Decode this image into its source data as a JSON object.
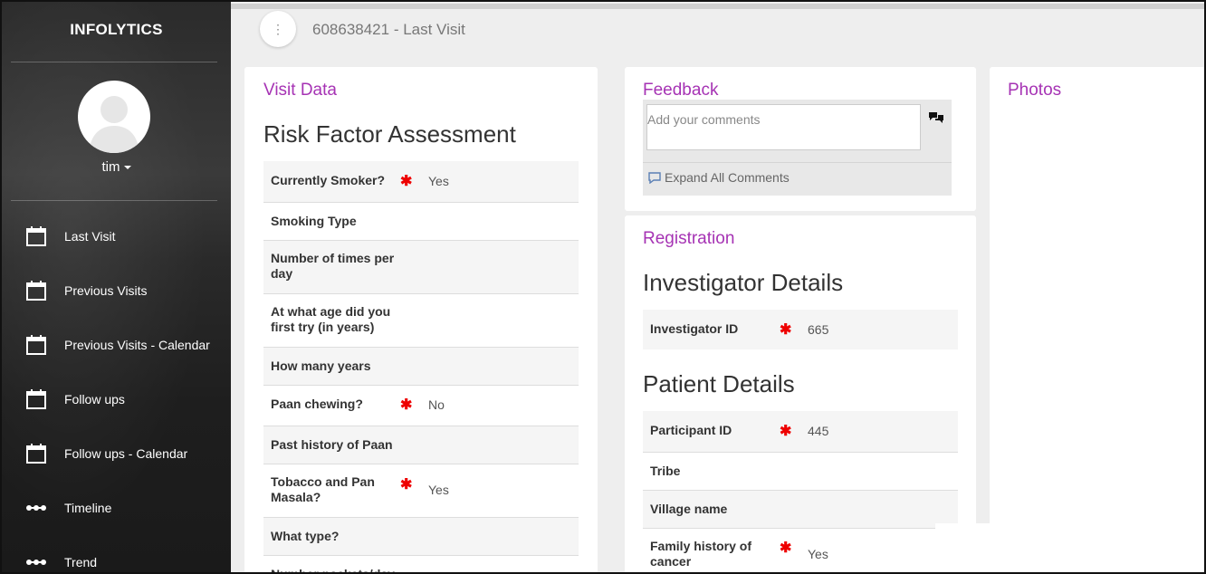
{
  "sidebar": {
    "brand": "INFOLYTICS",
    "user": "tim",
    "items": [
      {
        "label": "Last Visit",
        "icon": "calendar-icon"
      },
      {
        "label": "Previous Visits",
        "icon": "calendar-icon"
      },
      {
        "label": "Previous Visits - Calendar",
        "icon": "calendar-icon"
      },
      {
        "label": "Follow ups",
        "icon": "calendar-icon"
      },
      {
        "label": "Follow ups - Calendar",
        "icon": "calendar-icon"
      },
      {
        "label": "Timeline",
        "icon": "timeline-dots-icon"
      },
      {
        "label": "Trend",
        "icon": "timeline-dots-icon"
      }
    ]
  },
  "header": {
    "title": "608638421 - Last Visit",
    "menu_icon": "⋮"
  },
  "visit": {
    "card_title": "Visit Data",
    "section": "Risk Factor Assessment",
    "rows": [
      {
        "q": "Currently Smoker?",
        "required": "✱",
        "a": "Yes"
      },
      {
        "q": "Smoking Type",
        "required": "",
        "a": ""
      },
      {
        "q": "Number of times per day",
        "required": "",
        "a": ""
      },
      {
        "q": "At what age did you first try (in years)",
        "required": "",
        "a": ""
      },
      {
        "q": "How many years",
        "required": "",
        "a": ""
      },
      {
        "q": "Paan chewing?",
        "required": "✱",
        "a": "No"
      },
      {
        "q": "Past history of Paan",
        "required": "",
        "a": ""
      },
      {
        "q": "Tobacco and Pan Masala?",
        "required": "✱",
        "a": "Yes"
      },
      {
        "q": "What type?",
        "required": "",
        "a": ""
      },
      {
        "q": "Number packets/day",
        "required": "",
        "a": ""
      }
    ]
  },
  "feedback": {
    "card_title": "Feedback",
    "placeholder": "Add your comments",
    "expand_label": "Expand All Comments"
  },
  "registration": {
    "card_title": "Registration",
    "investigator_section": "Investigator Details",
    "investigator_rows": [
      {
        "q": "Investigator ID",
        "required": "✱",
        "a": "665"
      }
    ],
    "patient_section": "Patient Details",
    "patient_rows": [
      {
        "q": "Participant ID",
        "required": "✱",
        "a": "445"
      },
      {
        "q": "Tribe",
        "required": "",
        "a": ""
      },
      {
        "q": "Village name",
        "required": "",
        "a": ""
      },
      {
        "q": "Family history of cancer",
        "required": "✱",
        "a": "Yes"
      }
    ]
  },
  "photos": {
    "card_title": "Photos"
  },
  "colors": {
    "accent": "#a633b4",
    "required": "#ee0000"
  }
}
